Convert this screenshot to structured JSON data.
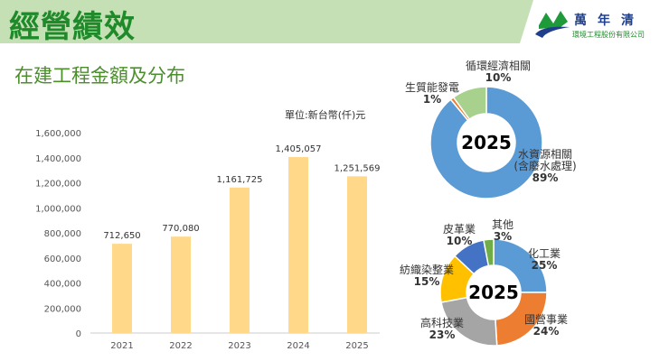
{
  "header": {
    "title": "經營績效",
    "company_name": "萬年清",
    "company_full": "環境工程股份有限公司",
    "band_color": "#c5e0b4"
  },
  "subtitle": "在建工程金額及分布",
  "chart_data": [
    {
      "type": "bar",
      "title": "",
      "unit_label": "單位:新台幣(仟)元",
      "categories": [
        "2021",
        "2022",
        "2023",
        "2024",
        "2025"
      ],
      "values": [
        712650,
        770080,
        1161725,
        1405057,
        1251569
      ],
      "data_labels": [
        "712,650",
        "770,080",
        "1,161,725",
        "1,405,057",
        "1,251,569"
      ],
      "yticks": [
        "0",
        "200,000",
        "400,000",
        "600,000",
        "800,000",
        "1,000,000",
        "1,200,000",
        "1,400,000",
        "1,600,000"
      ],
      "ylim": [
        0,
        1600000
      ],
      "grid": false,
      "color": "#ffd88a"
    },
    {
      "type": "pie",
      "center_label": "2025",
      "slices": [
        {
          "label": "水資源相關",
          "label2": "(含廢水處理)",
          "pct": "89%",
          "value": 89,
          "color": "#5b9bd5"
        },
        {
          "label": "生質能發電",
          "pct": "1%",
          "value": 1,
          "color": "#ed7d31"
        },
        {
          "label": "循環經濟相關",
          "pct": "10%",
          "value": 10,
          "color": "#a9d18e"
        }
      ]
    },
    {
      "type": "pie",
      "center_label": "2025",
      "slices": [
        {
          "label": "化工業",
          "pct": "25%",
          "value": 25,
          "color": "#5b9bd5"
        },
        {
          "label": "國營事業",
          "pct": "24%",
          "value": 24,
          "color": "#ed7d31"
        },
        {
          "label": "高科技業",
          "pct": "23%",
          "value": 23,
          "color": "#a5a5a5"
        },
        {
          "label": "紡織染整業",
          "pct": "15%",
          "value": 15,
          "color": "#ffc000"
        },
        {
          "label": "皮革業",
          "pct": "10%",
          "value": 10,
          "color": "#4472c4"
        },
        {
          "label": "其他",
          "pct": "3%",
          "value": 3,
          "color": "#70ad47"
        }
      ]
    }
  ]
}
